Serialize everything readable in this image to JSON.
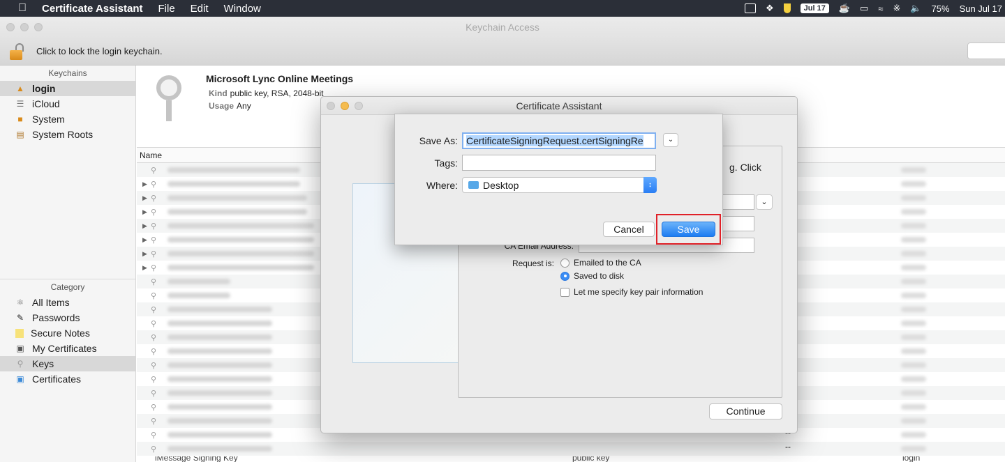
{
  "menubar": {
    "apple": "",
    "app_name": "Certificate Assistant",
    "menus": [
      "File",
      "Edit",
      "Window"
    ],
    "calendar_badge": "Jul 17",
    "battery": "75%",
    "clock": "Sun Jul 17"
  },
  "keychain_window": {
    "title": "Keychain Access",
    "lock_text": "Click to lock the login keychain."
  },
  "sidebar": {
    "keychains_title": "Keychains",
    "keychains": [
      {
        "label": "login",
        "icon": "lock-open-icon"
      },
      {
        "label": "iCloud",
        "icon": "cloud-icon"
      },
      {
        "label": "System",
        "icon": "lock-icon"
      },
      {
        "label": "System Roots",
        "icon": "cabinet-icon"
      }
    ],
    "category_title": "Category",
    "categories": [
      {
        "label": "All Items",
        "icon": "all-items-icon"
      },
      {
        "label": "Passwords",
        "icon": "passwords-icon"
      },
      {
        "label": "Secure Notes",
        "icon": "note-icon"
      },
      {
        "label": "My Certificates",
        "icon": "certificate-icon"
      },
      {
        "label": "Keys",
        "icon": "key-icon"
      },
      {
        "label": "Certificates",
        "icon": "certificate-icon"
      }
    ]
  },
  "detail": {
    "name": "Microsoft Lync Online Meetings",
    "kind_label": "Kind",
    "kind_value": "public key, RSA, 2048-bit",
    "usage_label": "Usage",
    "usage_value": "Any"
  },
  "list": {
    "name_header": "Name",
    "partial_row": "iMessage Signing Key",
    "partial_kind": "public key",
    "partial_keychain": "login",
    "dashes": [
      "--",
      "--"
    ]
  },
  "certificate_assistant": {
    "title": "Certificate Assistant",
    "box_text": "g. Click",
    "ca_email_label": "CA Email Address:",
    "request_is_label": "Request is:",
    "options": [
      {
        "label": "Emailed to the CA",
        "type": "radio",
        "checked": false
      },
      {
        "label": "Saved to disk",
        "type": "radio",
        "checked": true
      },
      {
        "label": "Let me specify key pair information",
        "type": "checkbox",
        "checked": false
      }
    ],
    "continue_label": "Continue"
  },
  "save_sheet": {
    "save_as_label": "Save As:",
    "save_as_value": "CertificateSigningRequest.certSigningRe",
    "tags_label": "Tags:",
    "tags_value": "",
    "where_label": "Where:",
    "where_value": "Desktop",
    "cancel_label": "Cancel",
    "save_label": "Save"
  }
}
